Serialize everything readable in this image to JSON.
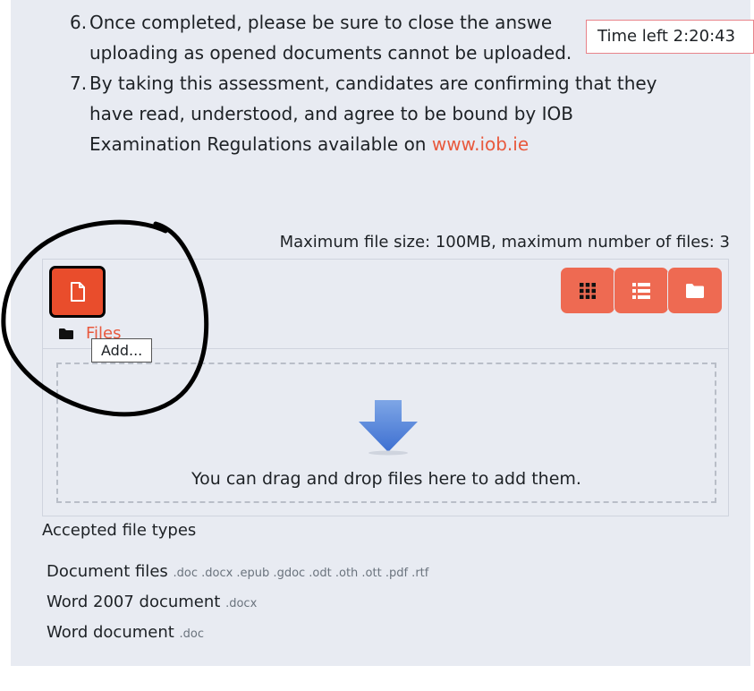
{
  "instructions": [
    {
      "num": "6.",
      "line1": "Once completed, please be sure to close the answe",
      "line2": "uploading as opened documents cannot be uploaded."
    },
    {
      "num": "7.",
      "line1": "By taking this assessment, candidates are confirming that they",
      "line2": "have read, understood, and agree to be bound by IOB",
      "line3": "Examination Regulations available on ",
      "link": "www.iob.ie"
    }
  ],
  "timer": {
    "label": "Time left 2:20:43"
  },
  "upload": {
    "limits": "Maximum file size: 100MB, maximum number of files: 3",
    "tooltip": "Add...",
    "files_label": "Files",
    "drop_text": "You can drag and drop files here to add them."
  },
  "accepted": {
    "heading": "Accepted file types",
    "types": [
      {
        "name": "Document files",
        "ext": ".doc .docx .epub .gdoc .odt .oth .ott .pdf .rtf"
      },
      {
        "name": "Word 2007 document",
        "ext": ".docx"
      },
      {
        "name": "Word document",
        "ext": ".doc"
      }
    ]
  },
  "icons": {
    "add": "file-icon",
    "files": "folder-icon",
    "view_grid": "grid-icon",
    "view_list": "list-icon",
    "view_tree": "folder-icon",
    "drop": "arrow-down-icon"
  },
  "colors": {
    "accent": "#e94d2c",
    "button": "#ee6a52",
    "link": "#e8593d",
    "panel": "#e8ebf2"
  }
}
